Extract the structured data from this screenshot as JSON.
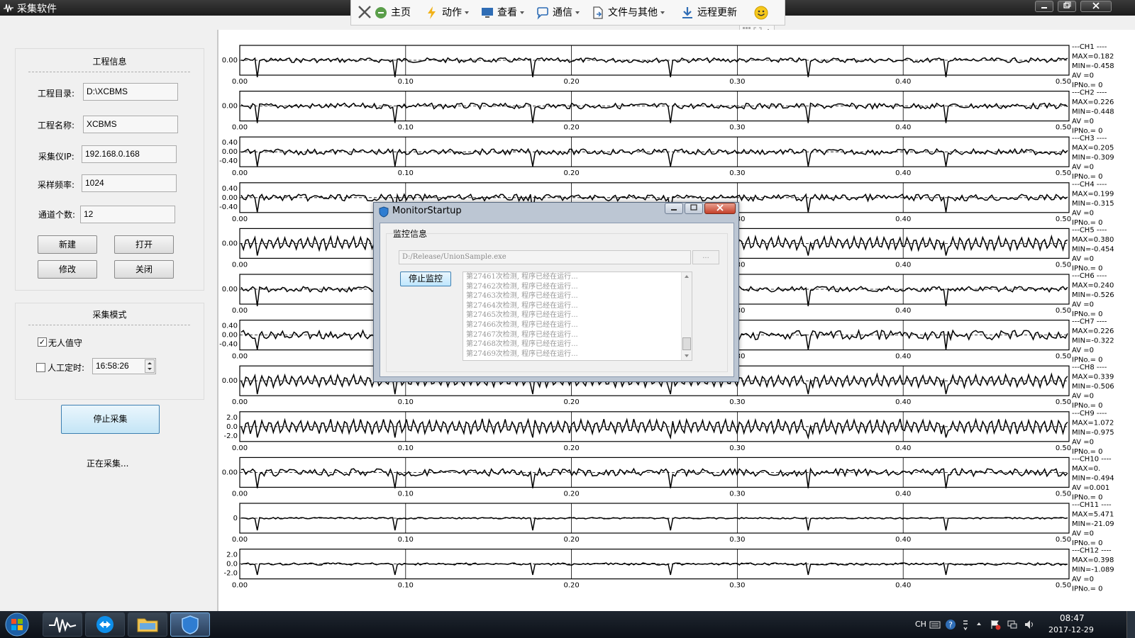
{
  "window": {
    "title": "采集软件"
  },
  "toolbar": {
    "items": [
      {
        "label": "主页",
        "icon": "home-icon",
        "has_menu": false
      },
      {
        "label": "动作",
        "icon": "lightning-icon",
        "has_menu": true
      },
      {
        "label": "查看",
        "icon": "monitor-icon",
        "has_menu": true
      },
      {
        "label": "通信",
        "icon": "chat-icon",
        "has_menu": true
      },
      {
        "label": "文件与其他",
        "icon": "file-transfer-icon",
        "has_menu": true
      },
      {
        "label": "远程更新",
        "icon": "download-icon",
        "has_menu": false
      }
    ]
  },
  "project_info": {
    "title": "工程信息",
    "dir_label": "工程目录:",
    "dir_value": "D:\\XCBMS",
    "name_label": "工程名称:",
    "name_value": "XCBMS",
    "ip_label": "采集仪IP:",
    "ip_value": "192.168.0.168",
    "freq_label": "采样频率:",
    "freq_value": "1024",
    "channels_label": "通道个数:",
    "channels_value": "12",
    "new_label": "新建",
    "open_label": "打开",
    "modify_label": "修改",
    "close_label": "关闭"
  },
  "acq_mode": {
    "title": "采集模式",
    "unattended_label": "无人值守",
    "unattended_checked": true,
    "manual_label": "人工定时:",
    "manual_checked": false,
    "time_value": "16:58:26"
  },
  "stop_acq_label": "停止采集",
  "status_text": "正在采集...",
  "x_ticks": [
    "0.00",
    "0.10",
    "0.20",
    "0.30",
    "0.40",
    "0.50"
  ],
  "channels": [
    {
      "name": "---CH1 ----",
      "max": "MAX=0.182",
      "min": "MIN=-0.458",
      "av": "AV =0",
      "ipno": "IPNo.= 0",
      "yticks": [
        "0.00"
      ],
      "amp": 0.25,
      "spike": 1.4
    },
    {
      "name": "---CH2 ----",
      "max": "MAX=0.226",
      "min": "MIN=-0.448",
      "av": "AV =0",
      "ipno": "IPNo.= 0",
      "yticks": [
        "0.00"
      ],
      "amp": 0.3,
      "spike": 1.4
    },
    {
      "name": "---CH3 ----",
      "max": "MAX=0.205",
      "min": "MIN=-0.309",
      "av": "AV =0",
      "ipno": "IPNo.= 0",
      "yticks": [
        "0.40",
        "0.00",
        "-0.40"
      ],
      "amp": 0.3,
      "spike": 1.2
    },
    {
      "name": "---CH4 ----",
      "max": "MAX=0.199",
      "min": "MIN=-0.315",
      "av": "AV =0",
      "ipno": "IPNo.= 0",
      "yticks": [
        "0.40",
        "0.00",
        "-0.40"
      ],
      "amp": 0.35,
      "spike": 1.2
    },
    {
      "name": "---CH5 ----",
      "max": "MAX=0.380",
      "min": "MIN=-0.454",
      "av": "AV =0",
      "ipno": "IPNo.= 0",
      "yticks": [
        "0.00"
      ],
      "amp": 0.75,
      "spike": 1.0
    },
    {
      "name": "---CH6 ----",
      "max": "MAX=0.240",
      "min": "MIN=-0.526",
      "av": "AV =0",
      "ipno": "IPNo.= 0",
      "yticks": [
        "0.00"
      ],
      "amp": 0.3,
      "spike": 1.4
    },
    {
      "name": "---CH7 ----",
      "max": "MAX=0.226",
      "min": "MIN=-0.322",
      "av": "AV =0",
      "ipno": "IPNo.= 0",
      "yticks": [
        "0.40",
        "0.00",
        "-0.40"
      ],
      "amp": 0.5,
      "spike": 1.2
    },
    {
      "name": "---CH8 ----",
      "max": "MAX=0.339",
      "min": "MIN=-0.506",
      "av": "AV =0",
      "ipno": "IPNo.= 0",
      "yticks": [
        "0.00"
      ],
      "amp": 0.7,
      "spike": 1.1
    },
    {
      "name": "---CH9 ----",
      "max": "MAX=1.072",
      "min": "MIN=-0.975",
      "av": "AV =0",
      "ipno": "IPNo.= 0",
      "yticks": [
        "2.0",
        "0.0",
        "-2.0"
      ],
      "amp": 0.85,
      "spike": 0.9
    },
    {
      "name": "---CH10 ----",
      "max": "MAX=0.",
      "min": "MIN=-0.494",
      "av": "AV =0.001",
      "ipno": "IPNo.= 0",
      "yticks": [
        "0.00"
      ],
      "amp": 0.4,
      "spike": 1.3
    },
    {
      "name": "---CH11 ----",
      "max": "MAX=5.471",
      "min": "MIN=-21.09",
      "av": "AV =0",
      "ipno": "IPNo.= 0",
      "yticks": [
        "0"
      ],
      "amp": 0.08,
      "spike": 1.0
    },
    {
      "name": "---CH12 ----",
      "max": "MAX=0.398",
      "min": "MIN=-1.089",
      "av": "AV =0",
      "ipno": "IPNo.= 0",
      "yticks": [
        "2.0",
        "0.0",
        "-2.0"
      ],
      "amp": 0.12,
      "spike": 0.9
    }
  ],
  "monitor_dialog": {
    "title": "MonitorStartup",
    "group_title": "监控信息",
    "path": "D:/Release/UnionSample.exe",
    "browse_label": "...",
    "stop_label": "停止监控",
    "log_lines": [
      "第27461次检测, 程序已经在运行...",
      "第27462次检测, 程序已经在运行...",
      "第27463次检测, 程序已经在运行...",
      "第27464次检测, 程序已经在运行...",
      "第27465次检测, 程序已经在运行...",
      "第27466次检测, 程序已经在运行...",
      "第27467次检测, 程序已经在运行...",
      "第27468次检测, 程序已经在运行...",
      "第27469次检测, 程序已经在运行..."
    ]
  },
  "taskbar": {
    "lang": "CH",
    "time": "08:47",
    "date": "2017-12-29"
  }
}
